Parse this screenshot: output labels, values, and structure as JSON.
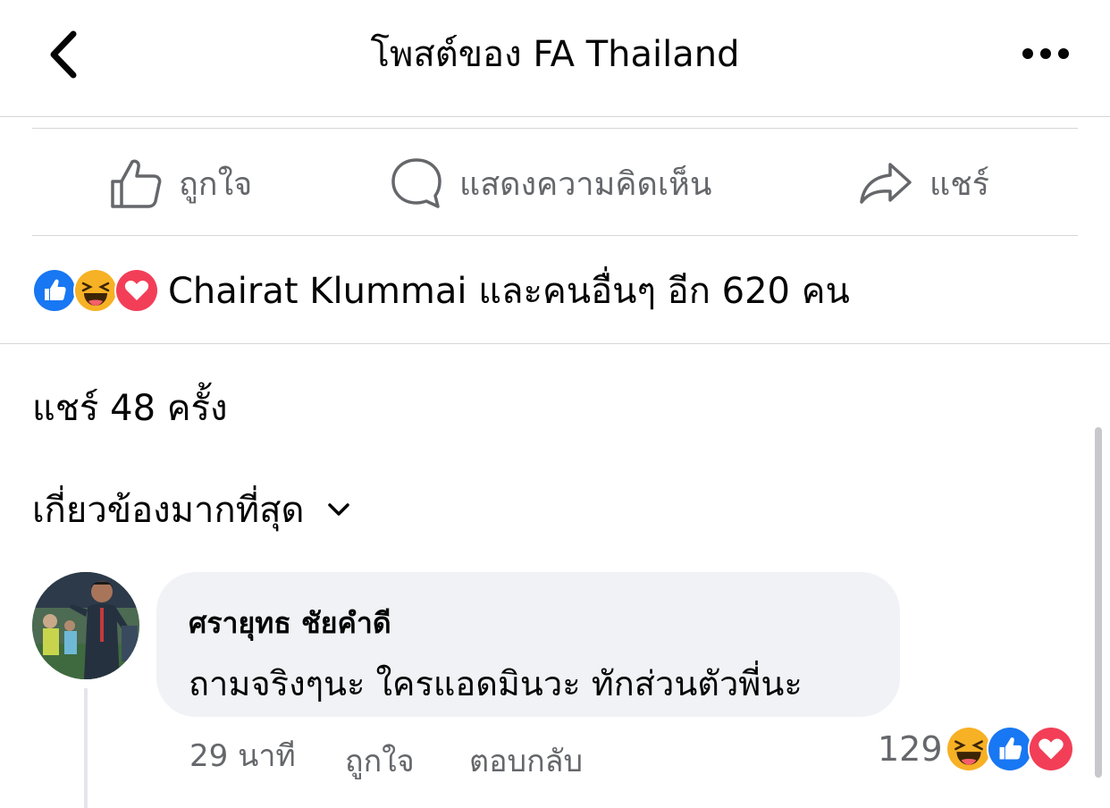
{
  "header": {
    "title": "โพสต์ของ FA Thailand"
  },
  "actions": {
    "like_label": "ถูกใจ",
    "comment_label": "แสดงความคิดเห็น",
    "share_label": "แชร์"
  },
  "reactions_summary": {
    "icons": [
      "like-icon",
      "haha-icon",
      "love-icon"
    ],
    "text": "Chairat Klummai และคนอื่นๆ อีก 620 คน"
  },
  "share_count": "แชร์ 48 ครั้ง",
  "sort": {
    "label": "เกี่ยวข้องมากที่สุด"
  },
  "comment": {
    "author": "ศรายุทธ ชัยคำดี",
    "text": "ถามจริงๆนะ ใครแอดมินวะ ทักส่วนตัวพี่นะ",
    "time": "29 นาที",
    "like_label": "ถูกใจ",
    "reply_label": "ตอบกลับ",
    "reaction_count": "129",
    "reaction_icons": [
      "haha-icon",
      "like-icon",
      "love-icon"
    ]
  },
  "colors": {
    "like_blue": "#1877f2",
    "love_red": "#f33e58",
    "haha_yellow": "#f7b125",
    "secondary_text": "#65676b",
    "bubble_bg": "#f0f2f5"
  }
}
